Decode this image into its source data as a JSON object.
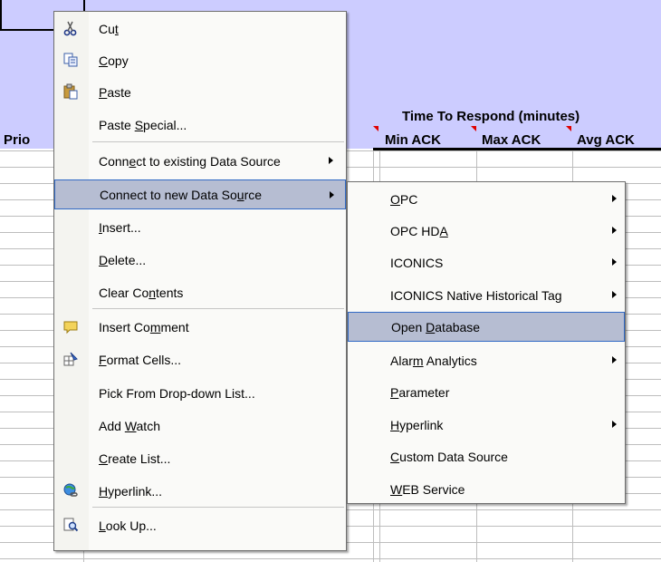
{
  "sheet": {
    "row_label_partial": "Prio",
    "group_header": "Time To Respond (minutes)",
    "columns": [
      "Min ACK",
      "Max ACK",
      "Avg ACK"
    ]
  },
  "context_menu": {
    "items": [
      {
        "label": "Cut",
        "underline": "t",
        "icon": "scissors-icon"
      },
      {
        "label": "Copy",
        "underline": "C",
        "icon": "copy-icon"
      },
      {
        "label": "Paste",
        "underline": "P",
        "icon": "paste-icon"
      },
      {
        "label": "Paste Special...",
        "underline": "S",
        "icon": ""
      },
      {
        "label": "Connect to existing Data Source",
        "underline": "e",
        "icon": "",
        "submenu": true
      },
      {
        "label": "Connect to new Data Source",
        "underline": "u",
        "icon": "",
        "submenu": true,
        "highlighted": true
      },
      {
        "label": "Insert...",
        "underline": "I",
        "icon": ""
      },
      {
        "label": "Delete...",
        "underline": "D",
        "icon": ""
      },
      {
        "label": "Clear Contents",
        "underline": "n",
        "icon": ""
      },
      {
        "label": "Insert Comment",
        "underline": "m",
        "icon": "comment-icon"
      },
      {
        "label": "Format Cells...",
        "underline": "F",
        "icon": "format-cells-icon"
      },
      {
        "label": "Pick From Drop-down List...",
        "underline": "K",
        "icon": ""
      },
      {
        "label": "Add Watch",
        "underline": "W",
        "icon": ""
      },
      {
        "label": "Create List...",
        "underline": "C",
        "icon": ""
      },
      {
        "label": "Hyperlink...",
        "underline": "H",
        "icon": "hyperlink-icon"
      },
      {
        "label": "Look Up...",
        "underline": "L",
        "icon": "lookup-icon"
      }
    ]
  },
  "submenu": {
    "items": [
      {
        "label": "OPC",
        "underline": "O",
        "submenu": true
      },
      {
        "label": "OPC HDA",
        "underline": "A",
        "submenu": true
      },
      {
        "label": "ICONICS",
        "underline": "",
        "submenu": true
      },
      {
        "label": "ICONICS Native Historical Tag",
        "underline": "",
        "submenu": true
      },
      {
        "label": "Open Database",
        "underline": "D",
        "submenu": false,
        "highlighted": true
      },
      {
        "label": "Alarm Analytics",
        "underline": "m",
        "submenu": true
      },
      {
        "label": "Parameter",
        "underline": "P",
        "submenu": false
      },
      {
        "label": "Hyperlink",
        "underline": "H",
        "submenu": true
      },
      {
        "label": "Custom Data Source",
        "underline": "C",
        "submenu": false
      },
      {
        "label": "WEB Service",
        "underline": "W",
        "submenu": false
      }
    ]
  },
  "colors": {
    "header_bg": "#ccccff",
    "highlight_bg": "#b6bdd2",
    "highlight_border": "#316ac5",
    "comment_marker": "#e00000"
  }
}
